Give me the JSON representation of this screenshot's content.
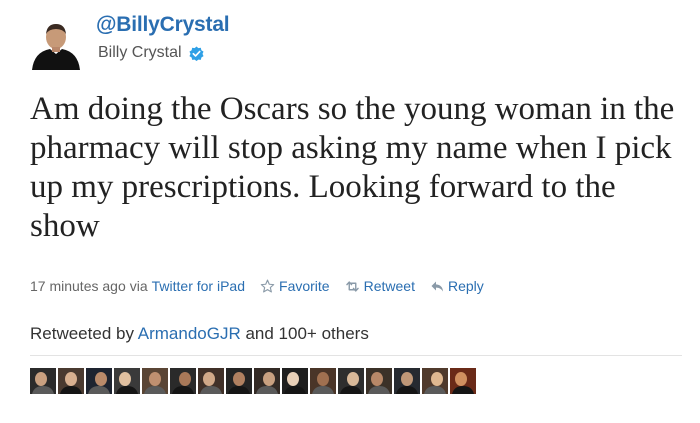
{
  "profile": {
    "screen_name": "@BillyCrystal",
    "display_name": "Billy Crystal",
    "avatar_icon": "user-avatar-photo",
    "verified_icon": "verified-badge-icon",
    "verified_color": "#2fa0e6"
  },
  "tweet": {
    "text": "Am doing the Oscars so the young woman in the pharmacy will stop asking my name when I pick up my prescriptions. Looking forward to the show"
  },
  "meta": {
    "timestamp": "17 minutes ago",
    "via_label": "via",
    "client": "Twitter for iPad",
    "favorite_label": "Favorite",
    "favorite_icon": "star-icon",
    "retweet_label": "Retweet",
    "retweet_icon": "retweet-icon",
    "reply_label": "Reply",
    "reply_icon": "reply-arrow-icon",
    "link_color": "#2a6eb1"
  },
  "retweets": {
    "prefix": "Retweeted by",
    "user": "ArmandoGJR",
    "suffix": "and 100+ others"
  },
  "retweeter_avatars": [
    {
      "icon": "retweeter-avatar-1"
    },
    {
      "icon": "retweeter-avatar-2"
    },
    {
      "icon": "retweeter-avatar-3"
    },
    {
      "icon": "retweeter-avatar-4"
    },
    {
      "icon": "retweeter-avatar-5"
    },
    {
      "icon": "retweeter-avatar-6"
    },
    {
      "icon": "retweeter-avatar-7"
    },
    {
      "icon": "retweeter-avatar-8"
    },
    {
      "icon": "retweeter-avatar-9"
    },
    {
      "icon": "retweeter-avatar-10"
    },
    {
      "icon": "retweeter-avatar-11"
    },
    {
      "icon": "retweeter-avatar-12"
    },
    {
      "icon": "retweeter-avatar-13"
    },
    {
      "icon": "retweeter-avatar-14"
    },
    {
      "icon": "retweeter-avatar-15"
    },
    {
      "icon": "retweeter-avatar-16"
    }
  ]
}
